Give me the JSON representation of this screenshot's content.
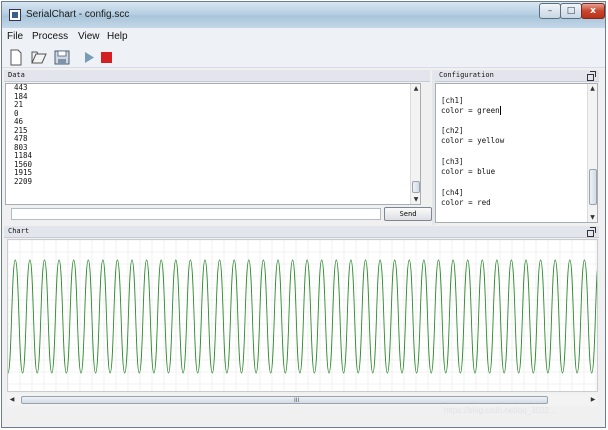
{
  "window": {
    "title": "SerialChart - config.scc"
  },
  "window_buttons": {
    "minimize": "–",
    "maximize": "□",
    "close": "x"
  },
  "menu": [
    {
      "label": "File"
    },
    {
      "label": "Process"
    },
    {
      "label": "View"
    },
    {
      "label": "Help"
    }
  ],
  "toolbar": {
    "icons": [
      "new-file-icon",
      "open-folder-icon",
      "save-disk-icon",
      "run-play-icon",
      "stop-icon"
    ],
    "accent_play": "#7a9bb6",
    "accent_stop": "#d42020"
  },
  "data_panel": {
    "title": "Data",
    "lines": [
      "443",
      "184",
      "21",
      "0",
      "46",
      "215",
      "478",
      "803",
      "1184",
      "1560",
      "1915",
      "2209"
    ],
    "send_label": "Send",
    "send_value": ""
  },
  "config_panel": {
    "title": "Configuration",
    "lines": [
      "[ch1]",
      "color = green",
      "[ch2]",
      "color = yellow",
      "[ch3]",
      "color = blue",
      "[ch4]",
      "color = red"
    ]
  },
  "chart_panel": {
    "title": "Chart",
    "scroll_grip": "III",
    "line_color": "#2e8b2e",
    "grid_color": "#e8e8e8"
  },
  "chart_data": {
    "type": "line",
    "series": [
      {
        "values": [
          10,
          3500,
          10,
          3500,
          10,
          3500,
          10,
          3500,
          10,
          3500,
          10,
          3500,
          10,
          3500,
          10,
          3500,
          10,
          3500,
          10,
          3500,
          10,
          3500,
          10,
          3500,
          10,
          3500,
          10,
          3500,
          10,
          3500,
          10,
          3500,
          10,
          3500,
          10,
          3500,
          10,
          3500,
          10,
          3500,
          10,
          3500,
          10,
          3500,
          10,
          3500,
          10,
          3500,
          10,
          3500,
          10,
          3500,
          10,
          3500,
          10,
          3500,
          10,
          3500,
          10,
          3500,
          10,
          3500,
          10,
          3500,
          10,
          3500,
          10,
          3500,
          10,
          3500,
          10,
          3500,
          10,
          3500,
          10,
          3500,
          10,
          3500,
          10,
          3500,
          10,
          3500
        ]
      }
    ],
    "grid": true
  },
  "watermark": "https://blog.csdn.net/qq_3022..."
}
